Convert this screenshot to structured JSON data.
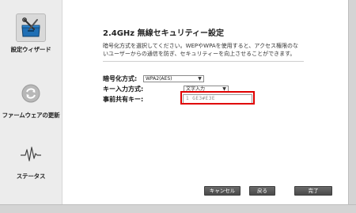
{
  "sidebar": {
    "items": [
      {
        "label": "設定ウィザード",
        "icon": "toolbox-icon",
        "active": true
      },
      {
        "label": "ファームウェアの更新",
        "icon": "refresh-icon",
        "active": false
      },
      {
        "label": "ステータス",
        "icon": "pulse-icon",
        "active": false
      }
    ]
  },
  "page": {
    "title": "2.4GHz 無線セキュリティー設定",
    "description": "暗号化方式を選択してください。WEPやWPAを使用すると、アクセス権限のないユーザーからの通信を防ぎ、セキュリティーを向上させることができます。"
  },
  "form": {
    "encryption": {
      "label": "暗号化方式:",
      "value": "WPA2(AES)"
    },
    "key_input_type": {
      "label": "キー入力方式:",
      "value": "文字入力"
    },
    "preshared_key": {
      "label": "事前共有キー:",
      "value": "1 GE3#E3E"
    }
  },
  "buttons": {
    "cancel": "キャンセル",
    "back": "戻る",
    "finish": "完了"
  },
  "colors": {
    "highlight": "#e00000",
    "button_bg": "#555555"
  }
}
